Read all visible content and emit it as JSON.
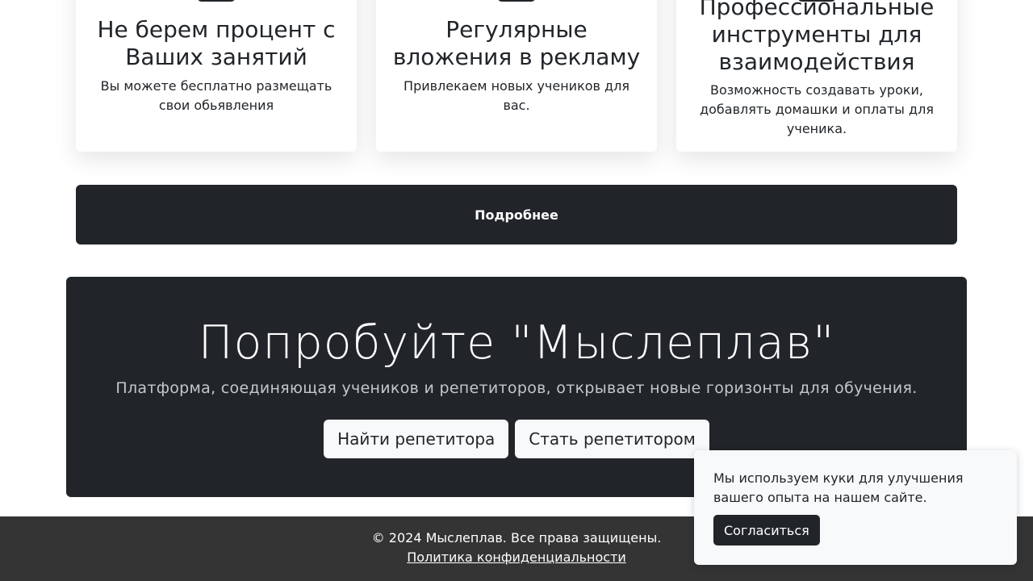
{
  "features": {
    "items": [
      {
        "title": "Не берем процент с Ваших занятий",
        "text": "Вы можете бесплатно размещать свои обьявления"
      },
      {
        "title": "Регулярные вложения в рекламу",
        "text": "Привлекаем новых учеников для вас."
      },
      {
        "title": "Профессиональные инструменты для взаимодействия",
        "text": "Возможность создавать уроки, добавлять домашки и оплаты для ученика."
      }
    ],
    "more_label": "Подробнее"
  },
  "cta": {
    "title": "Попробуйте \"Мыслеплав\"",
    "subtitle": "Платформа, соединяющая учеников и репетиторов, открывает новые горизонты для обучения.",
    "find_tutor_label": "Найти репетитора",
    "become_tutor_label": "Стать репетитором"
  },
  "footer": {
    "copyright": "© 2024 Мыслеплав. Все права защищены.",
    "privacy_link": "Политика конфиденциальности"
  },
  "cookie_banner": {
    "text": "Мы используем куки для улучшения вашего опыта на нашем сайте.",
    "accept_label": "Согласиться"
  },
  "colors": {
    "dark": "#212529",
    "footer_bg": "#343434",
    "light": "#f8f9fa"
  }
}
